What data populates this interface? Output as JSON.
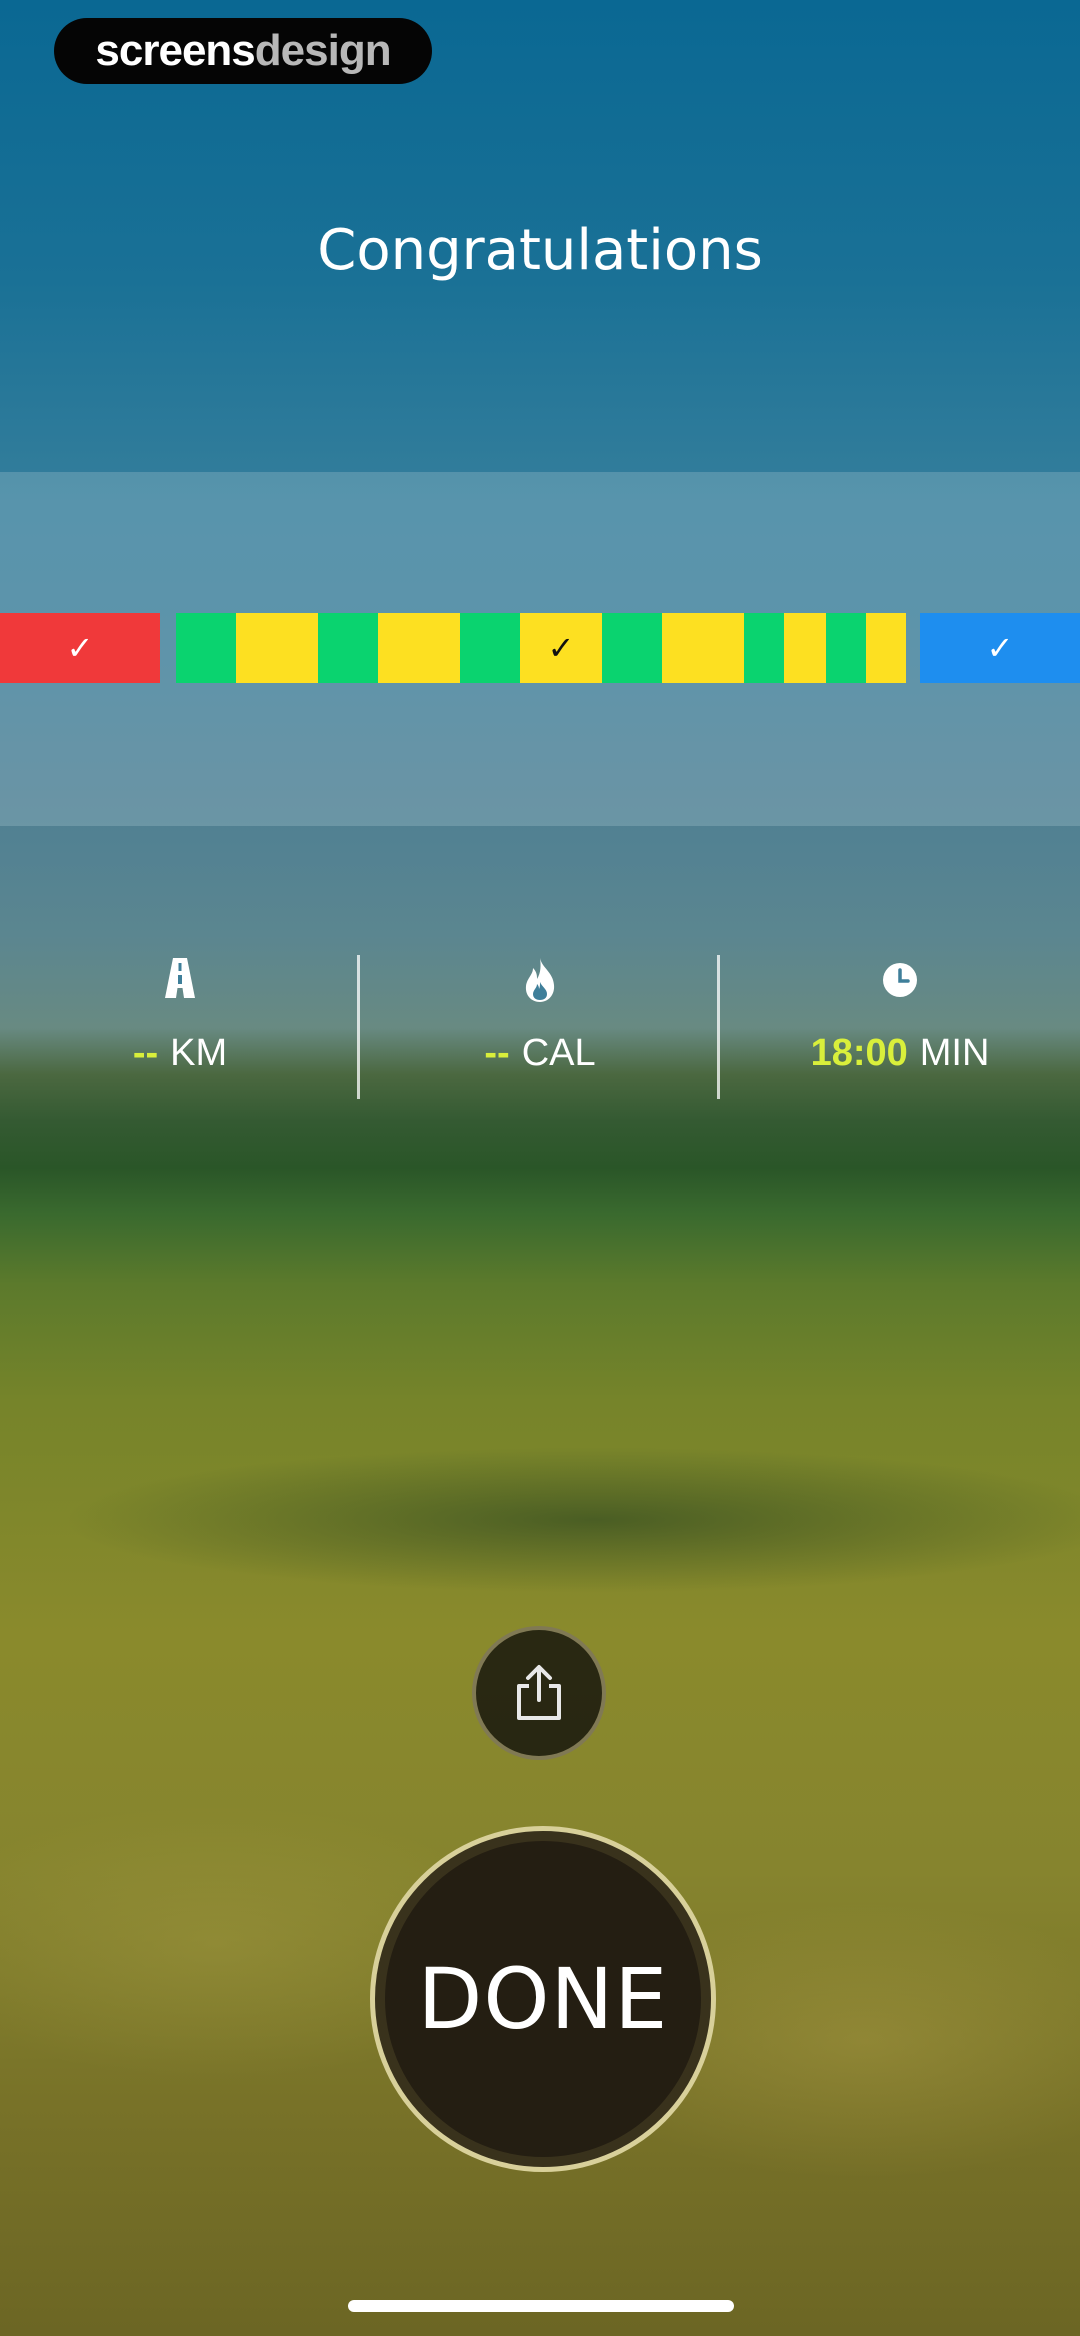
{
  "brand": {
    "part1": "screens",
    "part2": "design"
  },
  "title": "Congratulations",
  "segments": [
    {
      "color": "#f0393a",
      "tick": "✓",
      "tick_color": "#ffffff"
    },
    {
      "color": "#0ad36f"
    },
    {
      "color": "#fde021"
    },
    {
      "color": "#0ad36f"
    },
    {
      "color": "#fde021"
    },
    {
      "color": "#0ad36f"
    },
    {
      "color": "#fde021",
      "tick": "✓",
      "tick_color": "#111111"
    },
    {
      "color": "#0ad36f"
    },
    {
      "color": "#fde021"
    },
    {
      "color": "#0ad36f"
    },
    {
      "color": "#fde021"
    },
    {
      "color": "#0ad36f"
    },
    {
      "color": "#fde021"
    },
    {
      "color": "#1e8eef",
      "tick": "✓",
      "tick_color": "#ffffff"
    }
  ],
  "stats": [
    {
      "icon": "road-icon",
      "value": "--",
      "unit": "KM"
    },
    {
      "icon": "flame-icon",
      "value": "--",
      "unit": "CAL"
    },
    {
      "icon": "clock-icon",
      "value": "18:00",
      "unit": "MIN"
    }
  ],
  "colors": {
    "value_accent": "#d9ef3b",
    "done_ring": "#d8d09a"
  },
  "share_icon": "share-icon",
  "done_label": "DONE"
}
